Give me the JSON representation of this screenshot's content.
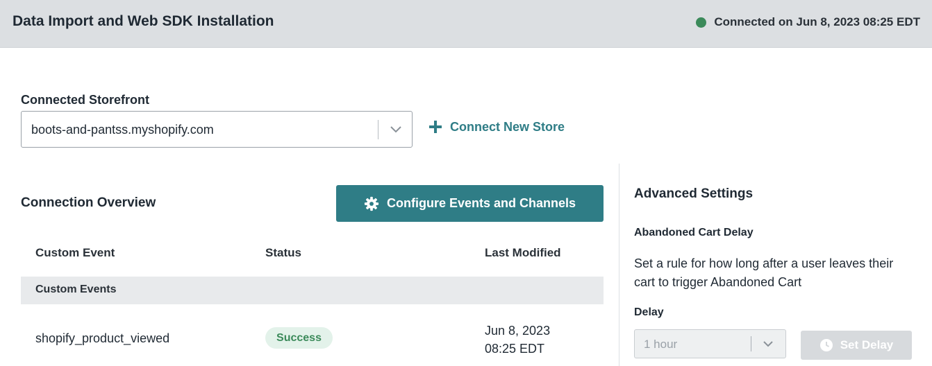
{
  "header": {
    "title": "Data Import and Web SDK Installation",
    "status_text": "Connected on Jun 8, 2023 08:25 EDT",
    "status_color": "#3b8a5a"
  },
  "storefront": {
    "label": "Connected Storefront",
    "selected": "boots-and-pantss.myshopify.com",
    "connect_label": "Connect New Store",
    "connect_icon": "plus-icon"
  },
  "overview": {
    "title": "Connection Overview",
    "configure_label": "Configure Events and Channels",
    "configure_icon": "gear-icon",
    "accent_color": "#2f7d86",
    "columns": [
      "Custom Event",
      "Status",
      "Last Modified"
    ],
    "group": "Custom Events",
    "rows": [
      {
        "event": "shopify_product_viewed",
        "status": "Success",
        "date_line1": "Jun 8, 2023",
        "date_line2": "08:25 EDT"
      }
    ]
  },
  "advanced": {
    "title": "Advanced Settings",
    "subtitle": "Abandoned Cart Delay",
    "description": "Set a rule for how long after a user leaves their cart to trigger Abandoned Cart",
    "delay_label": "Delay",
    "delay_value": "1 hour",
    "set_delay_label": "Set Delay",
    "set_delay_icon": "clock-icon"
  }
}
